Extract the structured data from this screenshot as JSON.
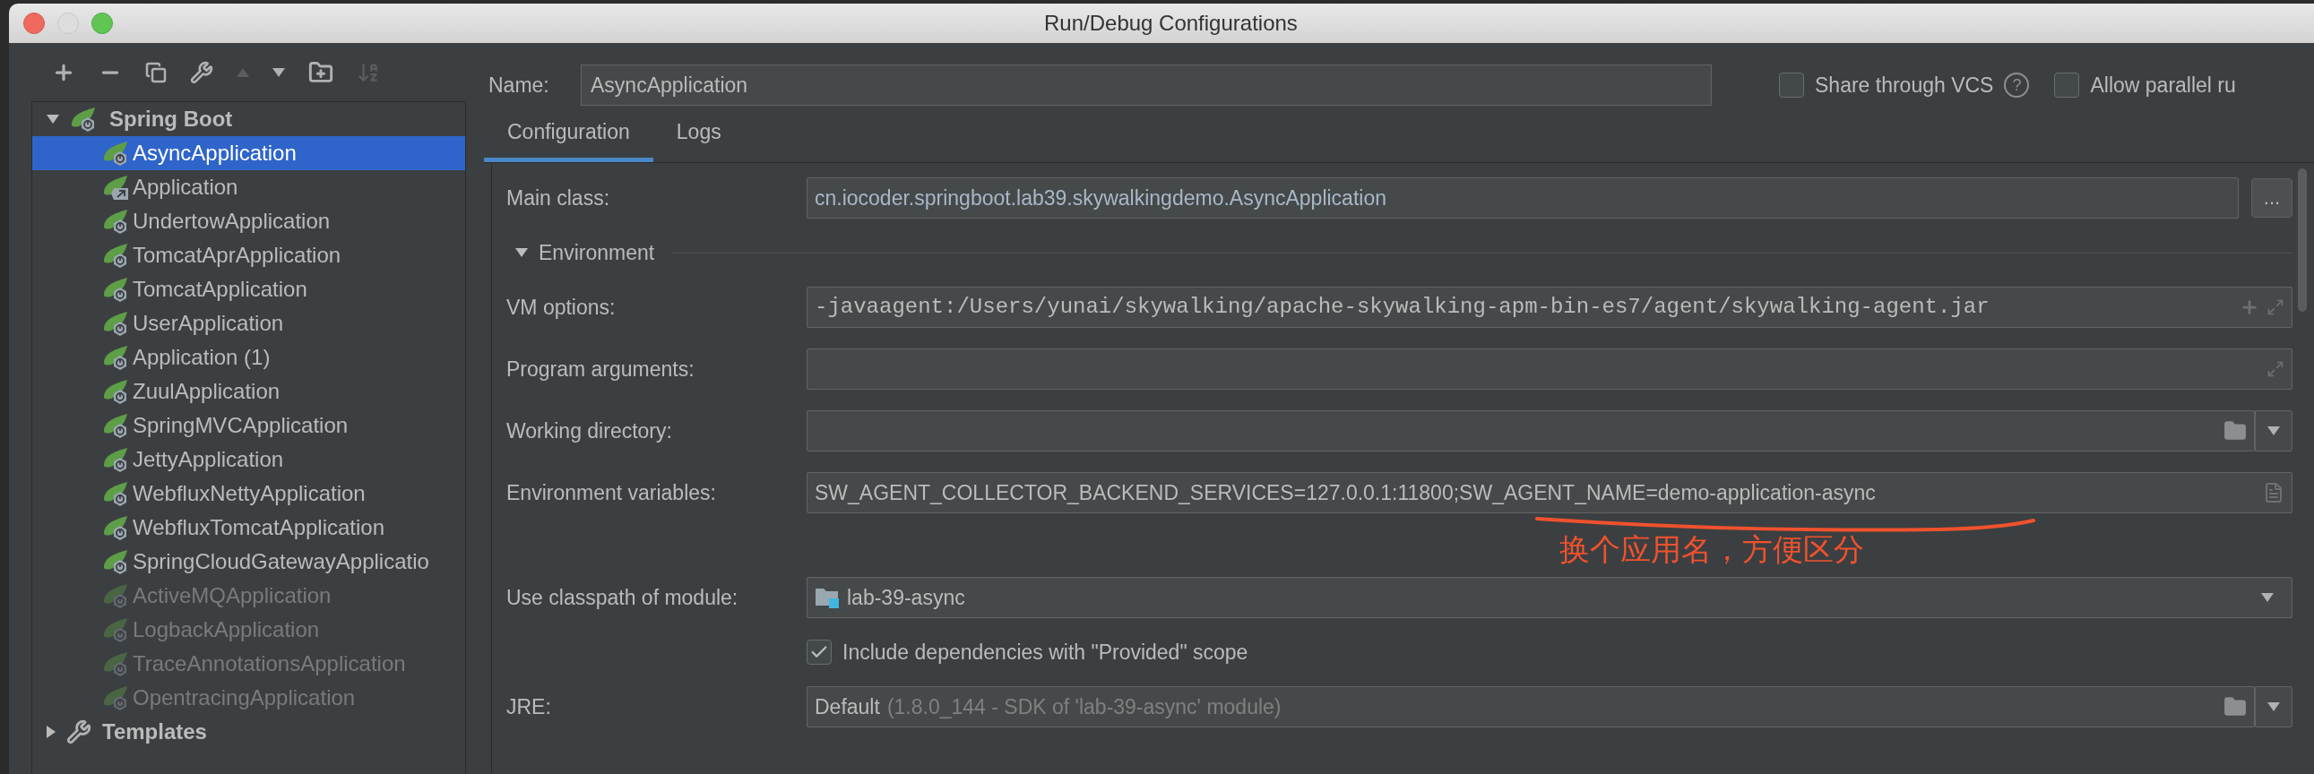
{
  "window": {
    "title": "Run/Debug Configurations"
  },
  "toolbar": [
    {
      "kind": "add",
      "disabled": false
    },
    {
      "kind": "remove",
      "disabled": false
    },
    {
      "kind": "copy",
      "disabled": false
    },
    {
      "kind": "edit",
      "disabled": false
    },
    {
      "kind": "up",
      "disabled": true
    },
    {
      "kind": "down",
      "disabled": false
    },
    {
      "kind": "folder",
      "disabled": false
    },
    {
      "kind": "sort",
      "disabled": true
    }
  ],
  "tree": [
    {
      "label": "Spring Boot",
      "kind": "spring",
      "expanded": true,
      "children": [
        {
          "label": "AsyncApplication",
          "kind": "boot",
          "selected": true,
          "disabled": false
        },
        {
          "label": "Application",
          "kind": "link",
          "selected": false,
          "disabled": false
        },
        {
          "label": "UndertowApplication",
          "kind": "boot",
          "selected": false,
          "disabled": false
        },
        {
          "label": "TomcatAprApplication",
          "kind": "boot",
          "selected": false,
          "disabled": false
        },
        {
          "label": "TomcatApplication",
          "kind": "boot",
          "selected": false,
          "disabled": false
        },
        {
          "label": "UserApplication",
          "kind": "boot",
          "selected": false,
          "disabled": false
        },
        {
          "label": "Application (1)",
          "kind": "boot",
          "selected": false,
          "disabled": false
        },
        {
          "label": "ZuulApplication",
          "kind": "boot",
          "selected": false,
          "disabled": false
        },
        {
          "label": "SpringMVCApplication",
          "kind": "boot",
          "selected": false,
          "disabled": false
        },
        {
          "label": "JettyApplication",
          "kind": "boot",
          "selected": false,
          "disabled": false
        },
        {
          "label": "WebfluxNettyApplication",
          "kind": "boot",
          "selected": false,
          "disabled": false
        },
        {
          "label": "WebfluxTomcatApplication",
          "kind": "boot",
          "selected": false,
          "disabled": false
        },
        {
          "label": "SpringCloudGatewayApplicatio",
          "kind": "boot",
          "selected": false,
          "disabled": false
        },
        {
          "label": "ActiveMQApplication",
          "kind": "boot",
          "selected": false,
          "disabled": true
        },
        {
          "label": "LogbackApplication",
          "kind": "boot",
          "selected": false,
          "disabled": true
        },
        {
          "label": "TraceAnnotationsApplication",
          "kind": "boot",
          "selected": false,
          "disabled": true
        },
        {
          "label": "OpentracingApplication",
          "kind": "boot",
          "selected": false,
          "disabled": true
        }
      ]
    },
    {
      "label": "Templates",
      "kind": "templates",
      "expanded": false
    }
  ],
  "name": {
    "label": "Name:",
    "value": "AsyncApplication"
  },
  "options": [
    {
      "label": "Share through VCS",
      "checked": false,
      "help": "?"
    },
    {
      "label": "Allow parallel ru",
      "checked": false
    }
  ],
  "tabs": [
    {
      "label": "Configuration",
      "selected": true
    },
    {
      "label": "Logs",
      "selected": false
    }
  ],
  "rows": [
    {
      "kind": "class",
      "label": "Main class:",
      "value": "cn.iocoder.springboot.lab39.skywalkingdemo.AsyncApplication",
      "button": "..."
    },
    {
      "kind": "section",
      "label": "Environment",
      "expanded": true
    },
    {
      "kind": "vm",
      "label": "VM options:",
      "value": "-javaagent:/Users/yunai/skywalking/apache-skywalking-apm-bin-es7/agent/skywalking-agent.jar"
    },
    {
      "kind": "expand",
      "label": "Program arguments:"
    },
    {
      "kind": "path",
      "label": "Working directory:"
    },
    {
      "kind": "env",
      "label": "Environment variables:",
      "value": "SW_AGENT_COLLECTOR_BACKEND_SERVICES=127.0.0.1:11800;SW_AGENT_NAME=demo-application-async",
      "note": "换个应用名，方便区分"
    },
    {
      "kind": "module",
      "label": "Use classpath of module:",
      "value": "lab-39-async"
    },
    {
      "kind": "check",
      "label": "Include dependencies with \"Provided\" scope",
      "checked": true
    },
    {
      "kind": "jre",
      "label": "JRE:",
      "value": "Default",
      "detail": "(1.8.0_144 - SDK of 'lab-39-async' module)"
    }
  ]
}
